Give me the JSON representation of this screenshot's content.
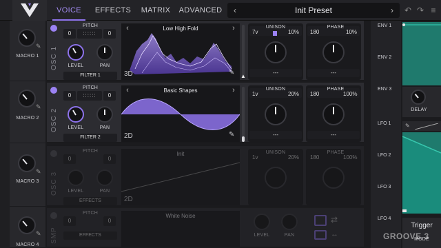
{
  "header": {
    "tabs": [
      {
        "label": "VOICE"
      },
      {
        "label": "EFFECTS"
      },
      {
        "label": "MATRIX"
      },
      {
        "label": "ADVANCED"
      }
    ],
    "preset_name": "Init Preset",
    "prev_glyph": "‹",
    "next_glyph": "›",
    "undo_glyph": "↶",
    "redo_glyph": "↷",
    "menu_glyph": "≡"
  },
  "macros": [
    {
      "label": "MACRO 1"
    },
    {
      "label": "MACRO 2"
    },
    {
      "label": "MACRO 3"
    },
    {
      "label": "MACRO 4"
    }
  ],
  "oscillators": [
    {
      "name": "OSC 1",
      "pitch_label": "PITCH",
      "octave": "0",
      "semitone": "0",
      "level_label": "LEVEL",
      "pan_label": "PAN",
      "filter": "FILTER 1",
      "wavetable": "Low High Fold",
      "dimension": "3D",
      "unison_label": "UNISON",
      "voices": "7v",
      "unison_pct": "10%",
      "phase_label": "PHASE",
      "phase_val": "180",
      "phase_pct": "10%",
      "dropdown": "---",
      "enabled": true
    },
    {
      "name": "OSC 2",
      "pitch_label": "PITCH",
      "octave": "0",
      "semitone": "0",
      "level_label": "LEVEL",
      "pan_label": "PAN",
      "filter": "FILTER 2",
      "wavetable": "Basic Shapes",
      "dimension": "2D",
      "unison_label": "UNISON",
      "voices": "1v",
      "unison_pct": "20%",
      "phase_label": "PHASE",
      "phase_val": "180",
      "phase_pct": "100%",
      "dropdown": "---",
      "enabled": true
    },
    {
      "name": "OSC 3",
      "pitch_label": "PITCH",
      "octave": "0",
      "semitone": "0",
      "level_label": "LEVEL",
      "pan_label": "PAN",
      "filter": "EFFECTS",
      "wavetable": "Init",
      "dimension": "2D",
      "unison_label": "UNISON",
      "voices": "1v",
      "unison_pct": "20%",
      "phase_label": "PHASE",
      "phase_val": "180",
      "phase_pct": "100%",
      "dropdown": "---",
      "enabled": false
    },
    {
      "name": "SMP",
      "pitch_label": "PITCH",
      "octave": "0",
      "semitone": "0",
      "level_label": "LEVEL",
      "pan_label": "PAN",
      "filter": "EFFECTS",
      "wavetable": "White Noise",
      "dimension": "",
      "enabled": false
    }
  ],
  "right": {
    "env": [
      "ENV 1",
      "ENV 2",
      "ENV 3"
    ],
    "lfo": [
      "LFO 1",
      "LFO 2",
      "LFO 3",
      "LFO 4"
    ],
    "delay_label": "DELAY",
    "trigger_label": "Trigger",
    "mode_label": "MODE"
  },
  "watermark": "GROOVE 3",
  "colors": {
    "accent": "#9b82f3",
    "env_green": "#1f7a6d",
    "background": "#1b1b1e"
  }
}
